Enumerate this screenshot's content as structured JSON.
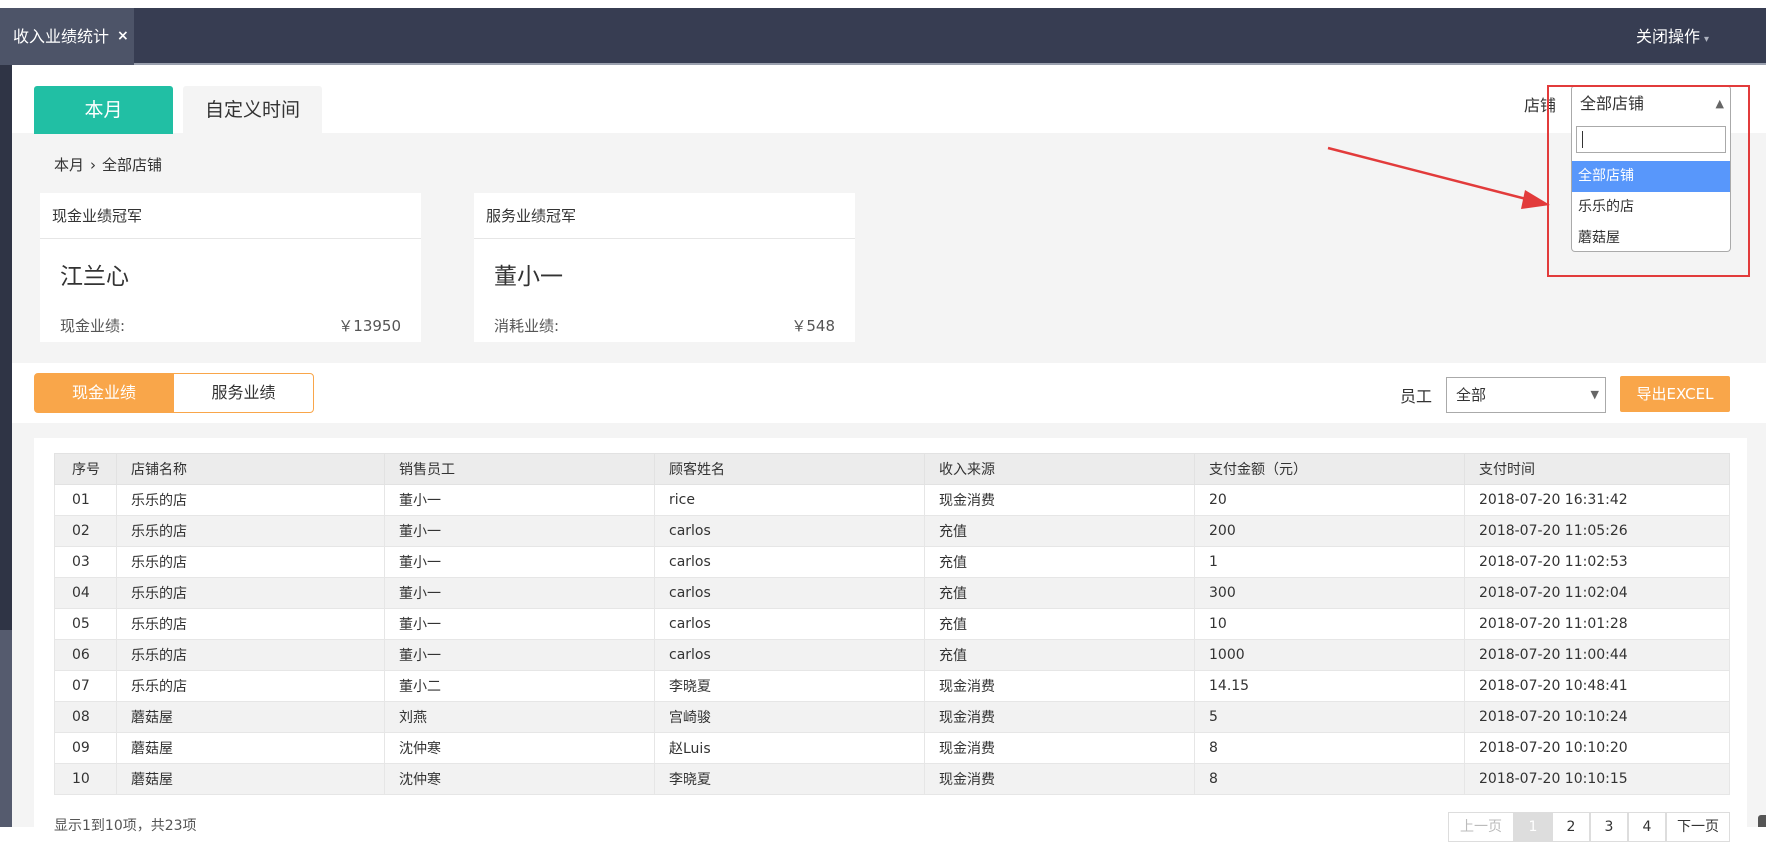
{
  "topbar": {
    "tab_label": "收入业绩统计",
    "tab_close": "×",
    "close_ops": "关闭操作",
    "close_ops_caret": "▾"
  },
  "period_tabs": {
    "month": "本月",
    "custom": "自定义时间"
  },
  "store_filter": {
    "label": "店铺",
    "selected": "全部店铺",
    "arrow": "▲",
    "search_value": "",
    "options": [
      "全部店铺",
      "乐乐的店",
      "蘑菇屋"
    ]
  },
  "breadcrumb": {
    "period": "本月",
    "sep": "›",
    "store": "全部店铺"
  },
  "cards": [
    {
      "title": "现金业绩冠军",
      "name": "江兰心",
      "metric_label": "现金业绩:",
      "amount": "￥13950"
    },
    {
      "title": "服务业绩冠军",
      "name": "董小一",
      "metric_label": "消耗业绩:",
      "amount": "￥548"
    }
  ],
  "segments": {
    "cash": "现金业绩",
    "service": "服务业绩"
  },
  "employee_filter": {
    "label": "员工",
    "selected": "全部",
    "arrow": "▼"
  },
  "export_label": "导出EXCEL",
  "table": {
    "headers": [
      "序号",
      "店铺名称",
      "销售员工",
      "顾客姓名",
      "收入来源",
      "支付金额（元）",
      "支付时间"
    ],
    "rows": [
      [
        "01",
        "乐乐的店",
        "董小一",
        "rice",
        "现金消费",
        "20",
        "2018-07-20 16:31:42"
      ],
      [
        "02",
        "乐乐的店",
        "董小一",
        "carlos",
        "充值",
        "200",
        "2018-07-20 11:05:26"
      ],
      [
        "03",
        "乐乐的店",
        "董小一",
        "carlos",
        "充值",
        "1",
        "2018-07-20 11:02:53"
      ],
      [
        "04",
        "乐乐的店",
        "董小一",
        "carlos",
        "充值",
        "300",
        "2018-07-20 11:02:04"
      ],
      [
        "05",
        "乐乐的店",
        "董小一",
        "carlos",
        "充值",
        "10",
        "2018-07-20 11:01:28"
      ],
      [
        "06",
        "乐乐的店",
        "董小一",
        "carlos",
        "充值",
        "1000",
        "2018-07-20 11:00:44"
      ],
      [
        "07",
        "乐乐的店",
        "董小二",
        "李晓夏",
        "现金消费",
        "14.15",
        "2018-07-20 10:48:41"
      ],
      [
        "08",
        "蘑菇屋",
        "刘燕",
        "宫崎骏",
        "现金消费",
        "5",
        "2018-07-20 10:10:24"
      ],
      [
        "09",
        "蘑菇屋",
        "沈仲寒",
        "赵Luis",
        "现金消费",
        "8",
        "2018-07-20 10:10:20"
      ],
      [
        "10",
        "蘑菇屋",
        "沈仲寒",
        "李晓夏",
        "现金消费",
        "8",
        "2018-07-20 10:10:15"
      ]
    ]
  },
  "pagination": {
    "info": "显示1到10项，共23项",
    "prev": "上一页",
    "pages": [
      "1",
      "2",
      "3",
      "4"
    ],
    "next": "下一页"
  },
  "colors": {
    "accent_teal": "#21bfa4",
    "accent_orange": "#f9a64a",
    "topbar": "#373d52",
    "highlight_red": "#e23b3b",
    "select_blue": "#5897fb"
  }
}
